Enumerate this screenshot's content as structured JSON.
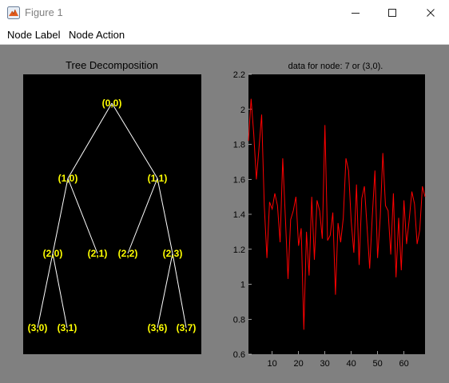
{
  "window": {
    "title": "Figure 1",
    "icon": "matlab-figure-icon"
  },
  "menu": {
    "items": [
      "Node Label",
      "Node Action"
    ]
  },
  "tree_panel": {
    "title": "Tree Decomposition",
    "nodes": [
      "(0,0)",
      "(1,0)",
      "(1,1)",
      "(2,0)",
      "(2,1)",
      "(2,2)",
      "(2,3)",
      "(3,0)",
      "(3,1)",
      "(3,6)",
      "(3,7)"
    ],
    "node_color": "#ffff00",
    "edge_color": "#ffffff"
  },
  "chart_data": {
    "type": "line",
    "title": "data for node: 7 or (3,0).",
    "xlabel": "",
    "ylabel": "",
    "xlim": [
      1,
      68
    ],
    "ylim": [
      0.6,
      2.2
    ],
    "xticks": [
      10,
      20,
      30,
      40,
      50,
      60
    ],
    "yticks": [
      0.6,
      0.8,
      1,
      1.2,
      1.4,
      1.6,
      1.8,
      2,
      2.2
    ],
    "series": [
      {
        "color": "#ff0000",
        "x": [
          1,
          2,
          3,
          4,
          5,
          6,
          7,
          8,
          9,
          10,
          11,
          12,
          13,
          14,
          15,
          16,
          17,
          18,
          19,
          20,
          21,
          22,
          23,
          24,
          25,
          26,
          27,
          28,
          29,
          30,
          31,
          32,
          33,
          34,
          35,
          36,
          37,
          38,
          39,
          40,
          41,
          42,
          43,
          44,
          45,
          46,
          47,
          48,
          49,
          50,
          51,
          52,
          53,
          54,
          55,
          56,
          57,
          58,
          59,
          60,
          61,
          62,
          63,
          64,
          65,
          66,
          67,
          68
        ],
        "values": [
          1.82,
          2.06,
          1.86,
          1.6,
          1.78,
          1.97,
          1.45,
          1.15,
          1.47,
          1.43,
          1.52,
          1.45,
          1.24,
          1.72,
          1.38,
          1.03,
          1.37,
          1.42,
          1.5,
          1.22,
          1.32,
          0.74,
          1.3,
          1.05,
          1.5,
          1.14,
          1.48,
          1.42,
          1.26,
          1.91,
          1.25,
          1.28,
          1.41,
          0.94,
          1.35,
          1.24,
          1.38,
          1.72,
          1.65,
          1.36,
          1.18,
          1.57,
          1.11,
          1.49,
          1.56,
          1.33,
          1.09,
          1.39,
          1.65,
          1.15,
          1.38,
          1.75,
          1.45,
          1.42,
          1.17,
          1.52,
          1.04,
          1.38,
          1.08,
          1.48,
          1.23,
          1.37,
          1.53,
          1.46,
          1.23,
          1.31,
          1.56,
          1.5
        ]
      }
    ]
  }
}
